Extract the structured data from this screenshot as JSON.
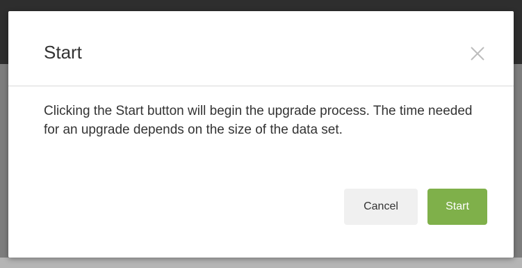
{
  "dialog": {
    "title": "Start",
    "body_text": "Clicking the Start button will begin the upgrade process. The time needed for an upgrade depends on the size of the data set.",
    "close_icon": "close-icon",
    "buttons": {
      "cancel_label": "Cancel",
      "start_label": "Start"
    }
  },
  "colors": {
    "primary_button": "#7fb04a",
    "secondary_button": "#f0f0f0",
    "backdrop_dark": "#2e2e2e"
  }
}
